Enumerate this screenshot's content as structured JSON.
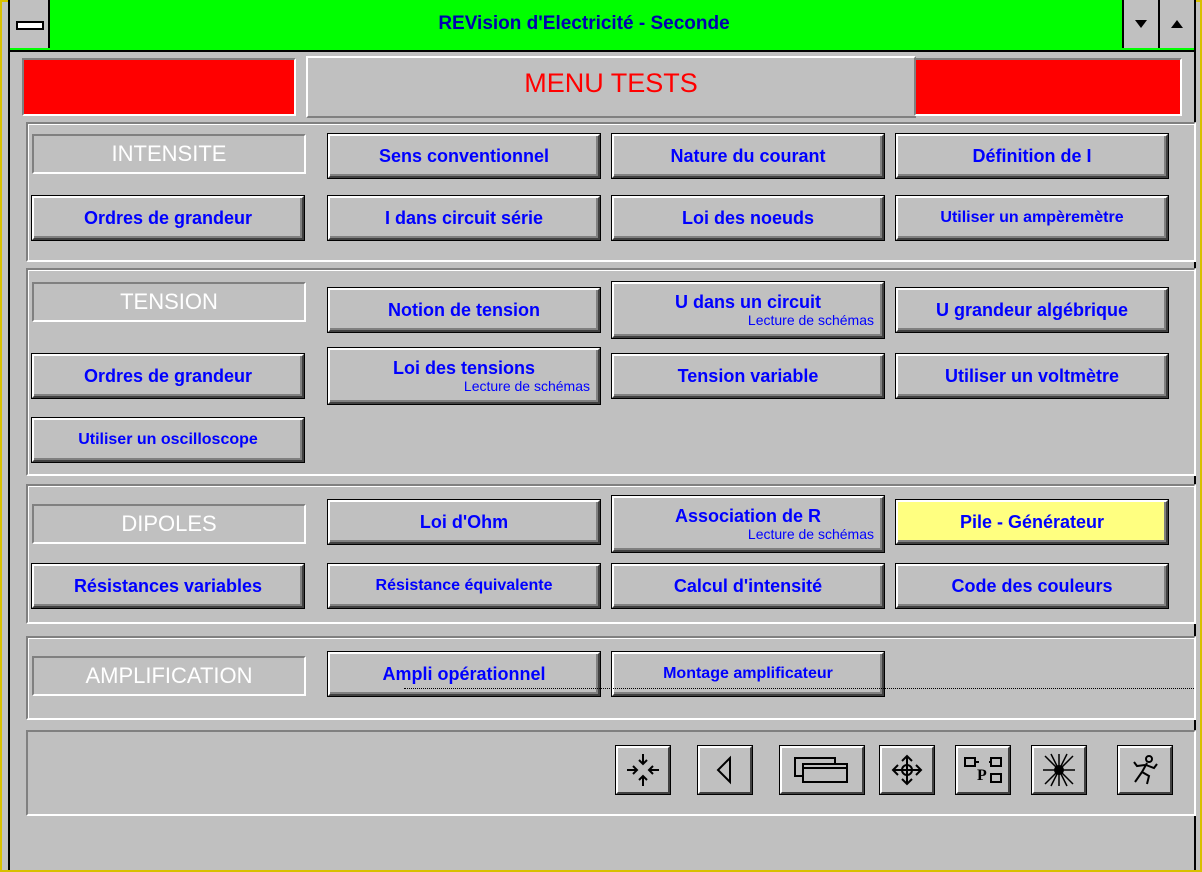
{
  "window": {
    "title": "REVision d'Electricité - Seconde"
  },
  "header": {
    "title": "MENU TESTS",
    "accent_color": "#ff0000",
    "titlebar_color": "#00ff00"
  },
  "groups": {
    "intensite": {
      "label": "INTENSITE",
      "buttons": {
        "b0": "Sens conventionnel",
        "b1": "Nature du courant",
        "b2": "Définition de I",
        "b3": "Ordres de grandeur",
        "b4": "I dans circuit série",
        "b5": "Loi des noeuds",
        "b6": "Utiliser un ampèremètre"
      }
    },
    "tension": {
      "label": "TENSION",
      "buttons": {
        "b0": "Notion de tension",
        "b1": "U dans un circuit",
        "b1_sub": "Lecture de schémas",
        "b2": "U grandeur algébrique",
        "b3": "Ordres de grandeur",
        "b4": "Loi des tensions",
        "b4_sub": "Lecture de schémas",
        "b5": "Tension variable",
        "b6": "Utiliser un voltmètre",
        "b7": "Utiliser un oscilloscope"
      }
    },
    "dipoles": {
      "label": "DIPOLES",
      "buttons": {
        "b0": "Loi d'Ohm",
        "b1": "Association de R",
        "b1_sub": "Lecture de schémas",
        "b2": "Pile - Générateur",
        "b3": "Résistances variables",
        "b4": "Résistance équivalente",
        "b5": "Calcul d'intensité",
        "b6": "Code des couleurs"
      }
    },
    "amplification": {
      "label": "AMPLIFICATION",
      "buttons": {
        "b0": "Ampli opérationnel",
        "b1": "Montage amplificateur"
      }
    }
  },
  "toolbar": {
    "icons": [
      "collapse-arrows-icon",
      "back-triangle-icon",
      "windows-stack-icon",
      "move-arrows-icon",
      "p-diagram-icon",
      "starburst-icon",
      "running-man-icon"
    ],
    "p_label": "P"
  }
}
